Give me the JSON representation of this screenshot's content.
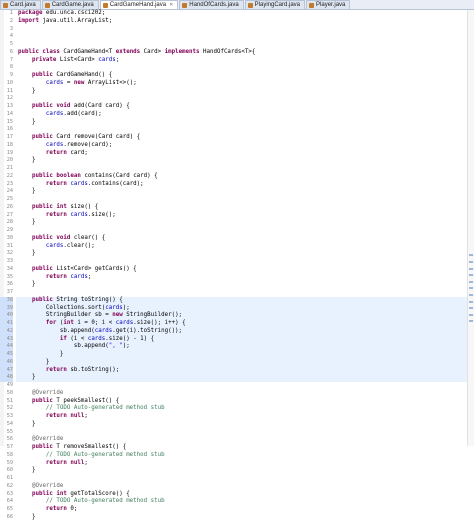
{
  "tabs": [
    {
      "label": "Card.java",
      "active": false
    },
    {
      "label": "CardGame.java",
      "active": false
    },
    {
      "label": "CardGameHand.java",
      "active": true
    },
    {
      "label": "HandOfCards.java",
      "active": false
    },
    {
      "label": "PlayingCard.java",
      "active": false
    },
    {
      "label": "Player.java",
      "active": false
    }
  ],
  "highlight_lines": [
    38,
    39,
    40,
    41,
    42,
    43,
    44,
    45,
    46,
    47,
    48
  ],
  "code": [
    [
      {
        "t": "package ",
        "c": "kw"
      },
      {
        "t": "edu.unca.csci202;"
      }
    ],
    [
      {
        "t": "import ",
        "c": "kw"
      },
      {
        "t": "java.util.ArrayList;"
      }
    ],
    [],
    [],
    [],
    [
      {
        "t": "public class ",
        "c": "kw"
      },
      {
        "t": "CardGameHand<T "
      },
      {
        "t": "extends ",
        "c": "kw"
      },
      {
        "t": "Card> "
      },
      {
        "t": "implements ",
        "c": "kw"
      },
      {
        "t": "HandOfCards<T>{"
      }
    ],
    [
      {
        "t": "    "
      },
      {
        "t": "private ",
        "c": "kw"
      },
      {
        "t": "List<Card> "
      },
      {
        "t": "cards",
        "c": "fld"
      },
      {
        "t": ";"
      }
    ],
    [],
    [
      {
        "t": "    "
      },
      {
        "t": "public ",
        "c": "kw"
      },
      {
        "t": "CardGameHand() {"
      }
    ],
    [
      {
        "t": "        "
      },
      {
        "t": "cards",
        "c": "fld"
      },
      {
        "t": " = "
      },
      {
        "t": "new ",
        "c": "kw"
      },
      {
        "t": "ArrayList<>();"
      }
    ],
    [
      {
        "t": "    }"
      }
    ],
    [],
    [
      {
        "t": "    "
      },
      {
        "t": "public void ",
        "c": "kw"
      },
      {
        "t": "add(Card card) {"
      }
    ],
    [
      {
        "t": "        "
      },
      {
        "t": "cards",
        "c": "fld"
      },
      {
        "t": ".add(card);"
      }
    ],
    [
      {
        "t": "    }"
      }
    ],
    [],
    [
      {
        "t": "    "
      },
      {
        "t": "public ",
        "c": "kw"
      },
      {
        "t": "Card remove(Card card) {"
      }
    ],
    [
      {
        "t": "        "
      },
      {
        "t": "cards",
        "c": "fld"
      },
      {
        "t": ".remove(card);"
      }
    ],
    [
      {
        "t": "        "
      },
      {
        "t": "return ",
        "c": "kw"
      },
      {
        "t": "card;"
      }
    ],
    [
      {
        "t": "    }"
      }
    ],
    [],
    [
      {
        "t": "    "
      },
      {
        "t": "public boolean ",
        "c": "kw"
      },
      {
        "t": "contains(Card card) {"
      }
    ],
    [
      {
        "t": "        "
      },
      {
        "t": "return ",
        "c": "kw"
      },
      {
        "t": "cards",
        "c": "fld"
      },
      {
        "t": ".contains(card);"
      }
    ],
    [
      {
        "t": "    }"
      }
    ],
    [],
    [
      {
        "t": "    "
      },
      {
        "t": "public int ",
        "c": "kw"
      },
      {
        "t": "size() {"
      }
    ],
    [
      {
        "t": "        "
      },
      {
        "t": "return ",
        "c": "kw"
      },
      {
        "t": "cards",
        "c": "fld"
      },
      {
        "t": ".size();"
      }
    ],
    [
      {
        "t": "    }"
      }
    ],
    [],
    [
      {
        "t": "    "
      },
      {
        "t": "public void ",
        "c": "kw"
      },
      {
        "t": "clear() {"
      }
    ],
    [
      {
        "t": "        "
      },
      {
        "t": "cards",
        "c": "fld"
      },
      {
        "t": ".clear();"
      }
    ],
    [
      {
        "t": "    }"
      }
    ],
    [],
    [
      {
        "t": "    "
      },
      {
        "t": "public ",
        "c": "kw"
      },
      {
        "t": "List<Card> getCards() {"
      }
    ],
    [
      {
        "t": "        "
      },
      {
        "t": "return ",
        "c": "kw"
      },
      {
        "t": "cards",
        "c": "fld"
      },
      {
        "t": ";"
      }
    ],
    [
      {
        "t": "    }"
      }
    ],
    [],
    [
      {
        "t": "    "
      },
      {
        "t": "public ",
        "c": "kw"
      },
      {
        "t": "String toString() {"
      }
    ],
    [
      {
        "t": "        Collections.sort("
      },
      {
        "t": "cards",
        "c": "fld"
      },
      {
        "t": ");"
      }
    ],
    [
      {
        "t": "        StringBuilder sb = "
      },
      {
        "t": "new ",
        "c": "kw"
      },
      {
        "t": "StringBuilder();"
      }
    ],
    [
      {
        "t": "        "
      },
      {
        "t": "for ",
        "c": "kw"
      },
      {
        "t": "("
      },
      {
        "t": "int ",
        "c": "kw"
      },
      {
        "t": "i = 0; i < "
      },
      {
        "t": "cards",
        "c": "fld"
      },
      {
        "t": ".size(); i++) {"
      }
    ],
    [
      {
        "t": "            sb.append("
      },
      {
        "t": "cards",
        "c": "fld"
      },
      {
        "t": ".get(i).toString());"
      }
    ],
    [
      {
        "t": "            "
      },
      {
        "t": "if ",
        "c": "kw"
      },
      {
        "t": "(i < "
      },
      {
        "t": "cards",
        "c": "fld"
      },
      {
        "t": ".size() - 1) {"
      }
    ],
    [
      {
        "t": "                sb.append("
      },
      {
        "t": "\", \"",
        "c": "str"
      },
      {
        "t": ");"
      }
    ],
    [
      {
        "t": "            }"
      }
    ],
    [
      {
        "t": "        }"
      }
    ],
    [
      {
        "t": "        "
      },
      {
        "t": "return ",
        "c": "kw"
      },
      {
        "t": "sb.toString();"
      }
    ],
    [
      {
        "t": "    }"
      }
    ],
    [],
    [
      {
        "t": "    "
      },
      {
        "t": "@Override",
        "c": "ann"
      }
    ],
    [
      {
        "t": "    "
      },
      {
        "t": "public ",
        "c": "kw"
      },
      {
        "t": "T peekSmallest() {"
      }
    ],
    [
      {
        "t": "        "
      },
      {
        "t": "// TODO Auto-generated method stub",
        "c": "cmt"
      }
    ],
    [
      {
        "t": "        "
      },
      {
        "t": "return null",
        "c": "kw"
      },
      {
        "t": ";"
      }
    ],
    [
      {
        "t": "    }"
      }
    ],
    [],
    [
      {
        "t": "    "
      },
      {
        "t": "@Override",
        "c": "ann"
      }
    ],
    [
      {
        "t": "    "
      },
      {
        "t": "public ",
        "c": "kw"
      },
      {
        "t": "T removeSmallest() {"
      }
    ],
    [
      {
        "t": "        "
      },
      {
        "t": "// TODO Auto-generated method stub",
        "c": "cmt"
      }
    ],
    [
      {
        "t": "        "
      },
      {
        "t": "return null",
        "c": "kw"
      },
      {
        "t": ";"
      }
    ],
    [
      {
        "t": "    }"
      }
    ],
    [],
    [
      {
        "t": "    "
      },
      {
        "t": "@Override",
        "c": "ann"
      }
    ],
    [
      {
        "t": "    "
      },
      {
        "t": "public int ",
        "c": "kw"
      },
      {
        "t": "getTotalScore() {"
      }
    ],
    [
      {
        "t": "        "
      },
      {
        "t": "// TODO Auto-generated method stub",
        "c": "cmt"
      }
    ],
    [
      {
        "t": "        "
      },
      {
        "t": "return ",
        "c": "kw"
      },
      {
        "t": "0;"
      }
    ],
    [
      {
        "t": "    }"
      }
    ]
  ]
}
